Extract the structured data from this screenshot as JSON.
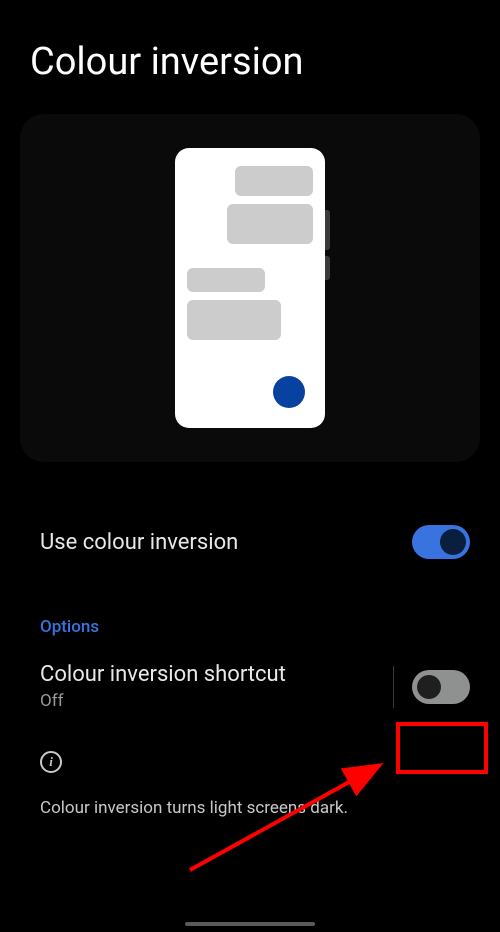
{
  "page": {
    "title": "Colour inversion"
  },
  "settings": {
    "use_inversion": {
      "label": "Use colour inversion",
      "enabled": true
    }
  },
  "options": {
    "header": "Options",
    "shortcut": {
      "label": "Colour inversion shortcut",
      "status": "Off",
      "enabled": false
    }
  },
  "info": {
    "description": "Colour inversion turns light screens dark."
  },
  "annotations": {
    "highlight": {
      "target": "shortcut-toggle"
    }
  }
}
